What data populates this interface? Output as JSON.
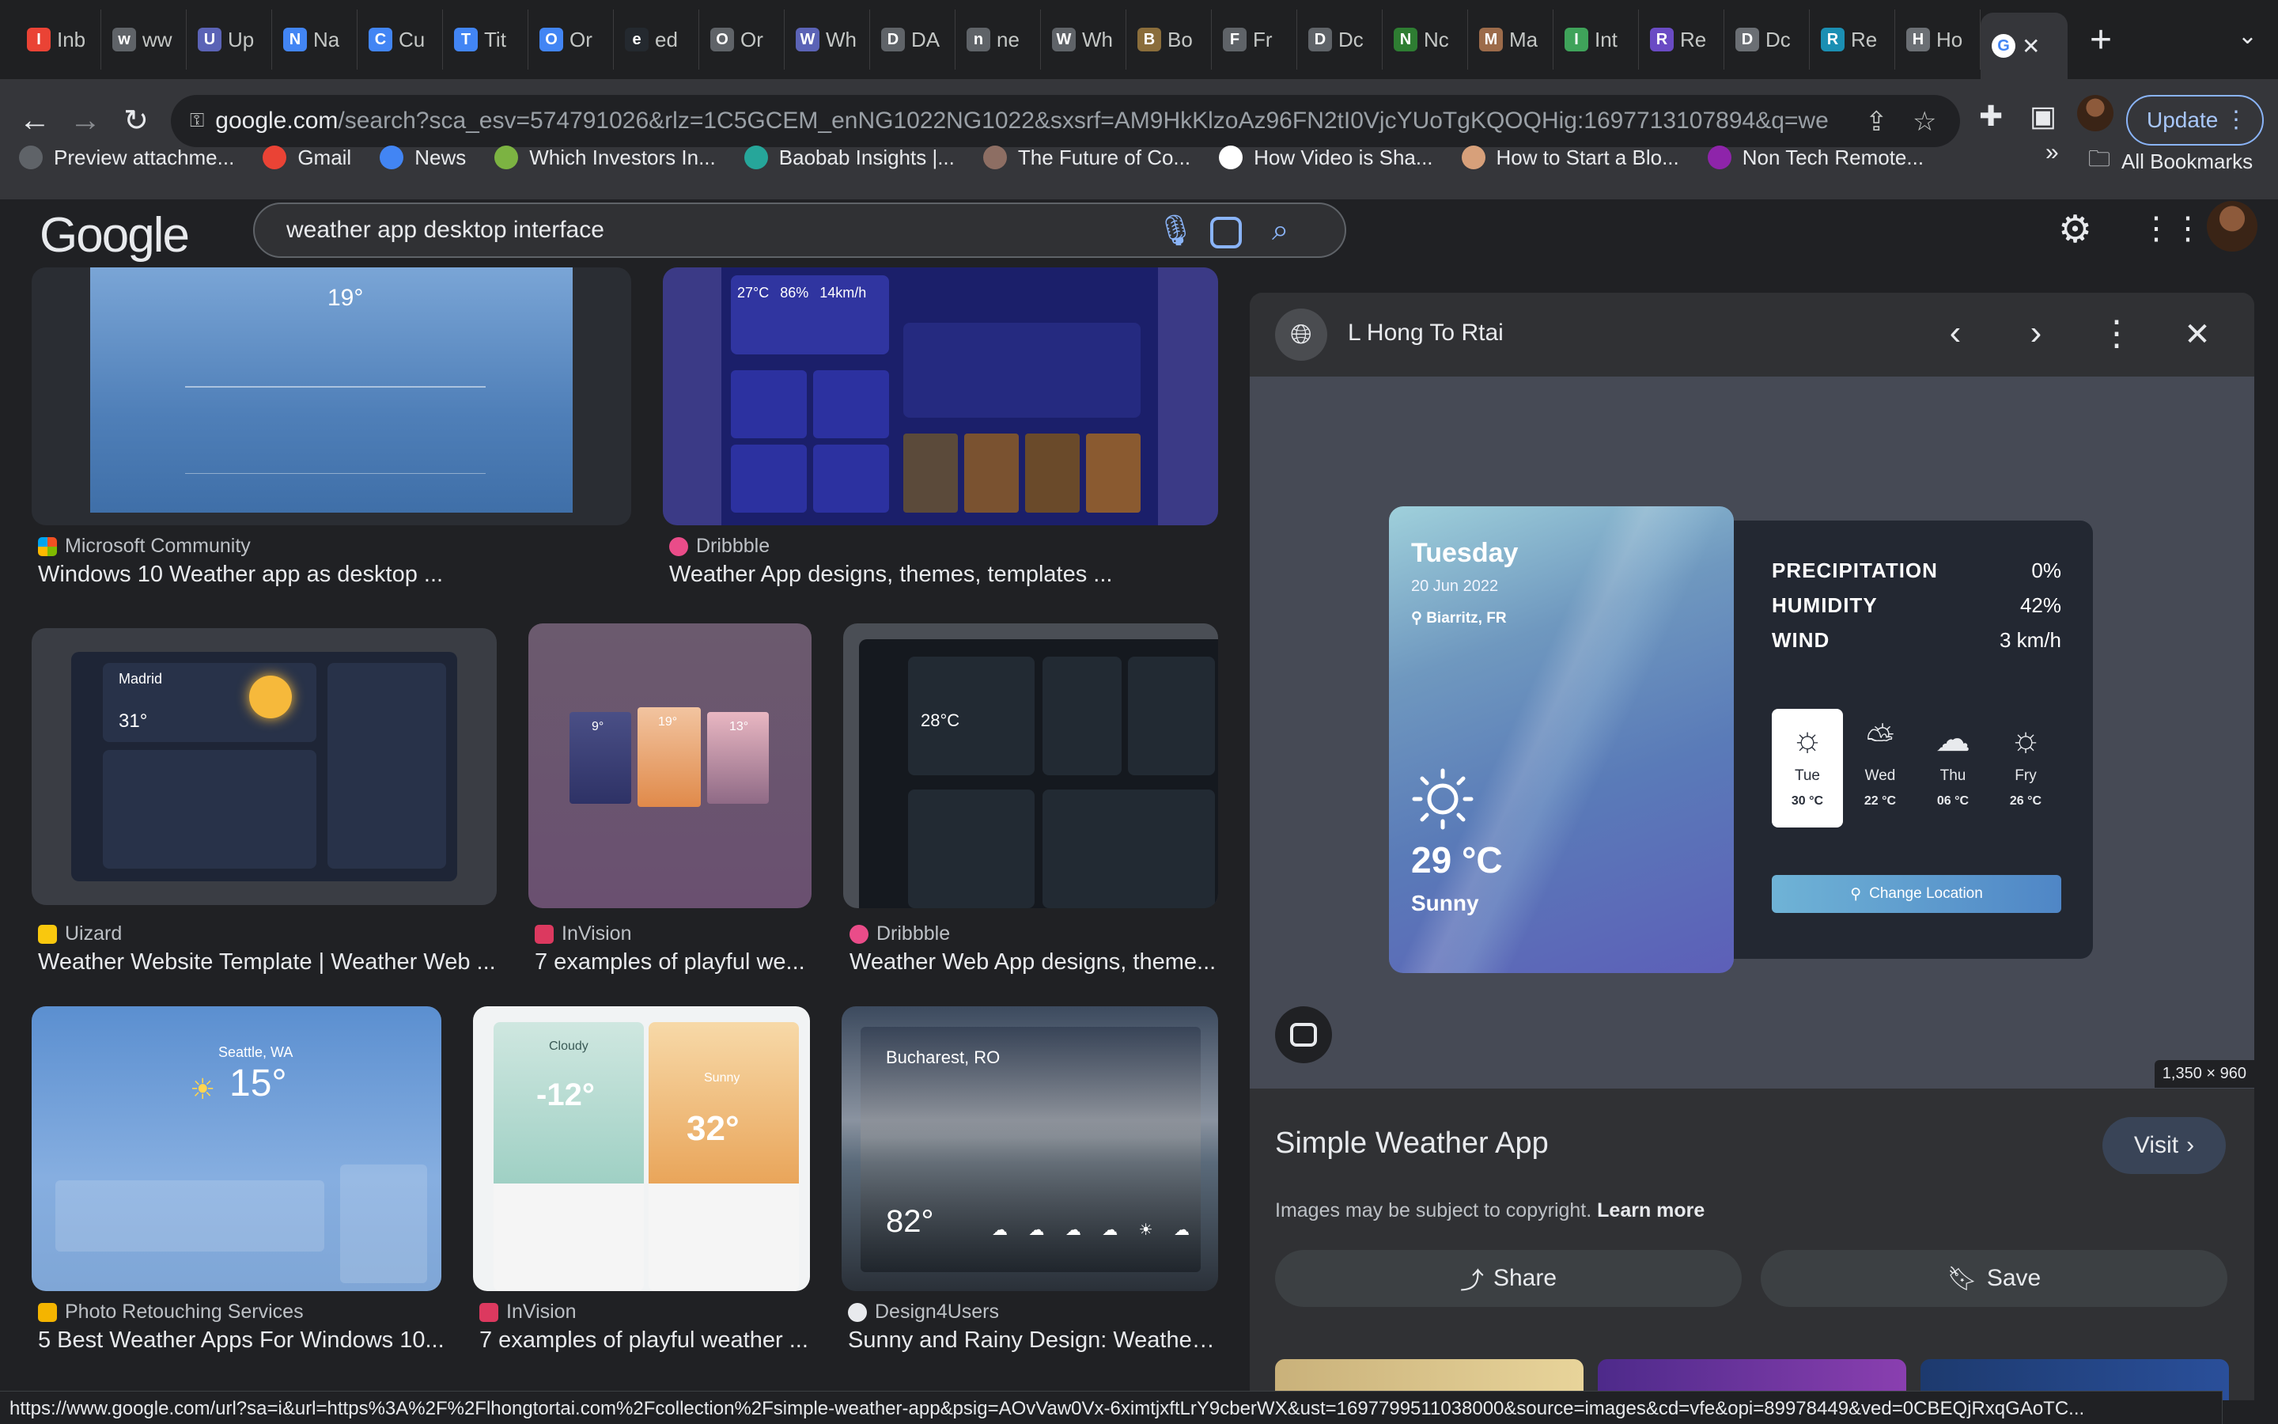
{
  "browser": {
    "tabs": [
      {
        "title": "Inb",
        "icon": "gmail-icon",
        "color": "#ea4335"
      },
      {
        "title": "ww",
        "icon": "openai-icon",
        "color": "#5f6368"
      },
      {
        "title": "Up",
        "icon": "ai-icon",
        "color": "#5b63b6"
      },
      {
        "title": "Na",
        "icon": "docs-icon",
        "color": "#4285f4"
      },
      {
        "title": "Cu",
        "icon": "docs-icon",
        "color": "#4285f4"
      },
      {
        "title": "Tit",
        "icon": "docs-icon",
        "color": "#4285f4"
      },
      {
        "title": "Or",
        "icon": "docs-icon",
        "color": "#4285f4"
      },
      {
        "title": "ed",
        "icon": "github-icon",
        "color": "#24292f"
      },
      {
        "title": "Or",
        "icon": "openai-icon",
        "color": "#5f6368"
      },
      {
        "title": "Wh",
        "icon": "ai-icon",
        "color": "#5b63b6"
      },
      {
        "title": "DA",
        "icon": "openai-icon",
        "color": "#5f6368"
      },
      {
        "title": "ne",
        "icon": "openai-icon",
        "color": "#5f6368"
      },
      {
        "title": "Wh",
        "icon": "openai-icon",
        "color": "#5f6368"
      },
      {
        "title": "Bo",
        "icon": "site-icon",
        "color": "#8a6d3b"
      },
      {
        "title": "Fr",
        "icon": "openai-icon",
        "color": "#5f6368"
      },
      {
        "title": "Dc",
        "icon": "openai-icon",
        "color": "#5f6368"
      },
      {
        "title": "Nc",
        "icon": "w-icon",
        "color": "#2e7d32"
      },
      {
        "title": "Ma",
        "icon": "site-icon",
        "color": "#9c6b4a"
      },
      {
        "title": "Int",
        "icon": "shield-icon",
        "color": "#3fa35a"
      },
      {
        "title": "Re",
        "icon": "ai-icon",
        "color": "#6a4bc4"
      },
      {
        "title": "Dc",
        "icon": "globe-icon",
        "color": "#6b6f74"
      },
      {
        "title": "Re",
        "icon": "react-icon",
        "color": "#1b8fb3"
      },
      {
        "title": "Ho",
        "icon": "globe-icon",
        "color": "#6b6f74"
      }
    ],
    "active_tab_icon": "google-icon",
    "url_domain": "google.com",
    "url_rest": "/search?sca_esv=574791026&rlz=1C5GCEM_enNG1022NG1022&sxsrf=AM9HkKlzoAz96FN2tI0VjcYUoTgKQOQHig:1697713107894&q=weath...",
    "update_label": "Update",
    "bookmarks": [
      {
        "label": "Preview attachme...",
        "icon": "globe-icon",
        "color": "#5f6368"
      },
      {
        "label": "Gmail",
        "icon": "gmail-icon",
        "color": "#ea4335"
      },
      {
        "label": "News",
        "icon": "news-icon",
        "color": "#4285f4"
      },
      {
        "label": "Which Investors In...",
        "icon": "leaf-icon",
        "color": "#7cb342"
      },
      {
        "label": "Baobab Insights |...",
        "icon": "baobab-icon",
        "color": "#26a69a"
      },
      {
        "label": "The Future of Co...",
        "icon": "site-icon",
        "color": "#8d6e63"
      },
      {
        "label": "How Video is Sha...",
        "icon": "dhl-icon",
        "color": "#ffffff"
      },
      {
        "label": "How to Start a Blo...",
        "icon": "face-icon",
        "color": "#d7a07a"
      },
      {
        "label": "Non Tech Remote...",
        "icon": "purple-icon",
        "color": "#8e24aa"
      }
    ],
    "all_bookmarks_label": "All Bookmarks",
    "status_url": "https://www.google.com/url?sa=i&url=https%3A%2F%2Flhongtortai.com%2Fcollection%2Fsimple-weather-app&psig=AOvVaw0Vx-6ximtjxftLrY9cberWX&ust=1697799511038000&source=images&cd=vfe&opi=89978449&ved=0CBEQjRxqGAoTC..."
  },
  "google": {
    "logo": "Google",
    "query": "weather app desktop interface"
  },
  "results": [
    {
      "source": "Microsoft Community",
      "caption": "Windows 10 Weather app as desktop ...",
      "favicon_color": "#f25022"
    },
    {
      "source": "Dribbble",
      "caption": "Weather App designs, themes, templates ...",
      "favicon_color": "#ea4c89"
    },
    {
      "source": "Uizard",
      "caption": "Weather Website Template | Weather Web ...",
      "favicon_color": "#f9c80e"
    },
    {
      "source": "InVision",
      "caption": "7 examples of playful we...",
      "favicon_color": "#dc395f"
    },
    {
      "source": "Dribbble",
      "caption": "Weather Web App designs, theme...",
      "favicon_color": "#ea4c89"
    },
    {
      "source": "Photo Retouching Services",
      "caption": "5 Best Weather Apps For Windows 10...",
      "favicon_color": "#f4b400"
    },
    {
      "source": "InVision",
      "caption": "7 examples of playful weather ...",
      "favicon_color": "#dc395f"
    },
    {
      "source": "Design4Users",
      "caption": "Sunny and Rainy Design: Weather ...",
      "favicon_color": "#e8eaed"
    }
  ],
  "thumb_text": {
    "madrid": "Madrid",
    "madrid_temp": "31°",
    "playful": [
      "9°",
      "19°",
      "13°"
    ],
    "dark_dash_temp": "28°C",
    "seattle": "Seattle, WA",
    "seattle_temp": "15°",
    "cloudy_temp": "-12°",
    "sunny_temp": "32°",
    "cloudy_label": "Cloudy",
    "sunny_label": "Sunny",
    "bucharest": "Bucharest, RO",
    "bucharest_temp": "82°",
    "ms_temp": "19°",
    "dribbble_stats": [
      "27°C",
      "86%",
      "14km/h"
    ]
  },
  "panel": {
    "site": "L Hong To Rtai",
    "title": "Simple Weather App",
    "visit_label": "Visit",
    "copyright": "Images may be subject to copyright.",
    "learn_more": "Learn more",
    "share_label": "Share",
    "save_label": "Save",
    "dimensions": "1,350 × 960",
    "weather": {
      "day": "Tuesday",
      "date": "20 Jun 2022",
      "location": "Biarritz, FR",
      "temp": "29 °C",
      "condition": "Sunny",
      "precipitation_label": "PRECIPITATION",
      "precipitation_value": "0%",
      "humidity_label": "HUMIDITY",
      "humidity_value": "42%",
      "wind_label": "WIND",
      "wind_value": "3 km/h",
      "forecast": [
        {
          "day": "Tue",
          "temp": "30 °C",
          "icon": "sun-icon"
        },
        {
          "day": "Wed",
          "temp": "22 °C",
          "icon": "partly-cloudy-icon"
        },
        {
          "day": "Thu",
          "temp": "06 °C",
          "icon": "rain-cloud-icon"
        },
        {
          "day": "Fry",
          "temp": "26 °C",
          "icon": "sun-icon"
        }
      ],
      "change_location_label": "Change Location"
    }
  }
}
